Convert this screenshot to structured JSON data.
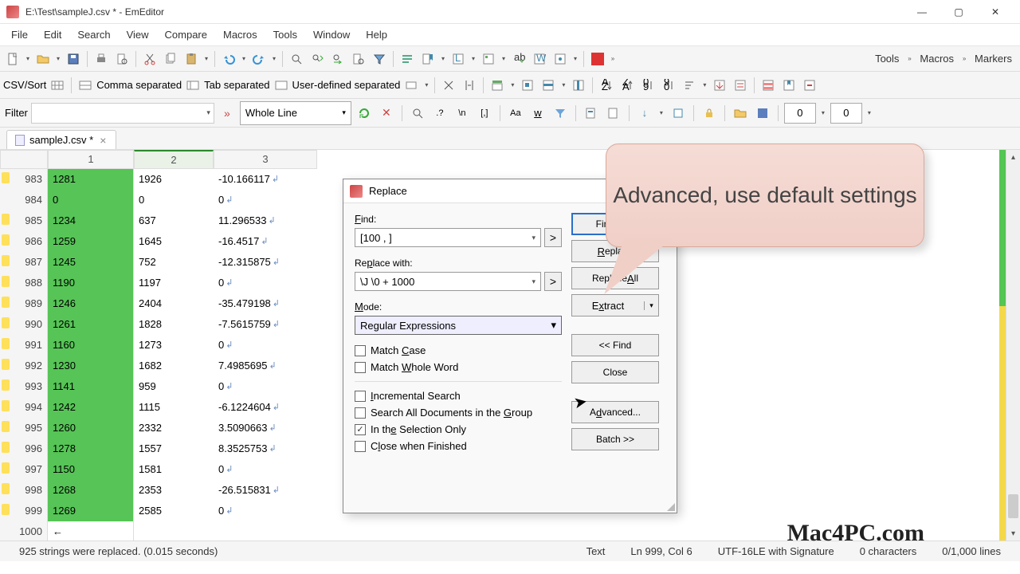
{
  "titlebar": {
    "title": "E:\\Test\\sampleJ.csv * - EmEditor"
  },
  "menu": [
    "File",
    "Edit",
    "Search",
    "View",
    "Compare",
    "Macros",
    "Tools",
    "Window",
    "Help"
  ],
  "toolbar_right": {
    "tools": "Tools",
    "macros": "Macros",
    "markers": "Markers"
  },
  "csvbar": {
    "label": "CSV/Sort",
    "comma": "Comma separated",
    "tab": "Tab separated",
    "user": "User-defined separated"
  },
  "filterbar": {
    "label": "Filter",
    "whole_line": "Whole Line",
    "num1": "0",
    "num2": "0"
  },
  "tab": {
    "name": "sampleJ.csv *"
  },
  "columns": [
    "1",
    "2",
    "3"
  ],
  "rows": [
    {
      "n": "983",
      "c1": "1281",
      "c2": "1926",
      "c3": "-10.166117",
      "mark": true
    },
    {
      "n": "984",
      "c1": "0",
      "c2": "0",
      "c3": "0",
      "mark": false
    },
    {
      "n": "985",
      "c1": "1234",
      "c2": "637",
      "c3": "11.296533",
      "mark": true
    },
    {
      "n": "986",
      "c1": "1259",
      "c2": "1645",
      "c3": "-16.4517",
      "mark": true
    },
    {
      "n": "987",
      "c1": "1245",
      "c2": "752",
      "c3": "-12.315875",
      "mark": true
    },
    {
      "n": "988",
      "c1": "1190",
      "c2": "1197",
      "c3": "0",
      "mark": true
    },
    {
      "n": "989",
      "c1": "1246",
      "c2": "2404",
      "c3": "-35.479198",
      "mark": true
    },
    {
      "n": "990",
      "c1": "1261",
      "c2": "1828",
      "c3": "-7.5615759",
      "mark": true
    },
    {
      "n": "991",
      "c1": "1160",
      "c2": "1273",
      "c3": "0",
      "mark": true
    },
    {
      "n": "992",
      "c1": "1230",
      "c2": "1682",
      "c3": "7.4985695",
      "mark": true
    },
    {
      "n": "993",
      "c1": "1141",
      "c2": "959",
      "c3": "0",
      "mark": true
    },
    {
      "n": "994",
      "c1": "1242",
      "c2": "1115",
      "c3": "-6.1224604",
      "mark": true
    },
    {
      "n": "995",
      "c1": "1260",
      "c2": "2332",
      "c3": "3.5090663",
      "mark": true
    },
    {
      "n": "996",
      "c1": "1278",
      "c2": "1557",
      "c3": "8.3525753",
      "mark": true
    },
    {
      "n": "997",
      "c1": "1150",
      "c2": "1581",
      "c3": "0",
      "mark": true
    },
    {
      "n": "998",
      "c1": "1268",
      "c2": "2353",
      "c3": "-26.515831",
      "mark": true
    },
    {
      "n": "999",
      "c1": "1269",
      "c2": "2585",
      "c3": "0",
      "mark": true
    },
    {
      "n": "1000",
      "c1": "←",
      "c2": "",
      "c3": "",
      "mark": false
    }
  ],
  "dialog": {
    "title": "Replace",
    "find_label": "Find:",
    "find_value": "[100 , ]",
    "replace_label": "Replace with:",
    "replace_value": "\\J \\0 + 1000",
    "mode_label": "Mode:",
    "mode_value": "Regular Expressions",
    "chk_case": "Match Case",
    "chk_whole": "Match Whole Word",
    "chk_incr": "Incremental Search",
    "chk_all": "Search All Documents in the Group",
    "chk_sel": "In the Selection Only",
    "chk_close": "Close when Finished",
    "btn_find_next": "Find Next",
    "btn_replace": "Replace",
    "btn_replace_all": "Replace All",
    "btn_extract": "Extract",
    "btn_prev_find": "<< Find",
    "btn_close": "Close",
    "btn_advanced": "Advanced...",
    "btn_batch": "Batch >>",
    "help": "?"
  },
  "callout": {
    "text": "Advanced, use default settings"
  },
  "status": {
    "left": "925 strings were replaced. (0.015 seconds)",
    "mode": "Text",
    "pos": "Ln 999, Col 6",
    "enc": "UTF-16LE with Signature",
    "sel": "0 characters",
    "lines": "0/1,000 lines"
  },
  "watermark": "Mac4PC.com"
}
